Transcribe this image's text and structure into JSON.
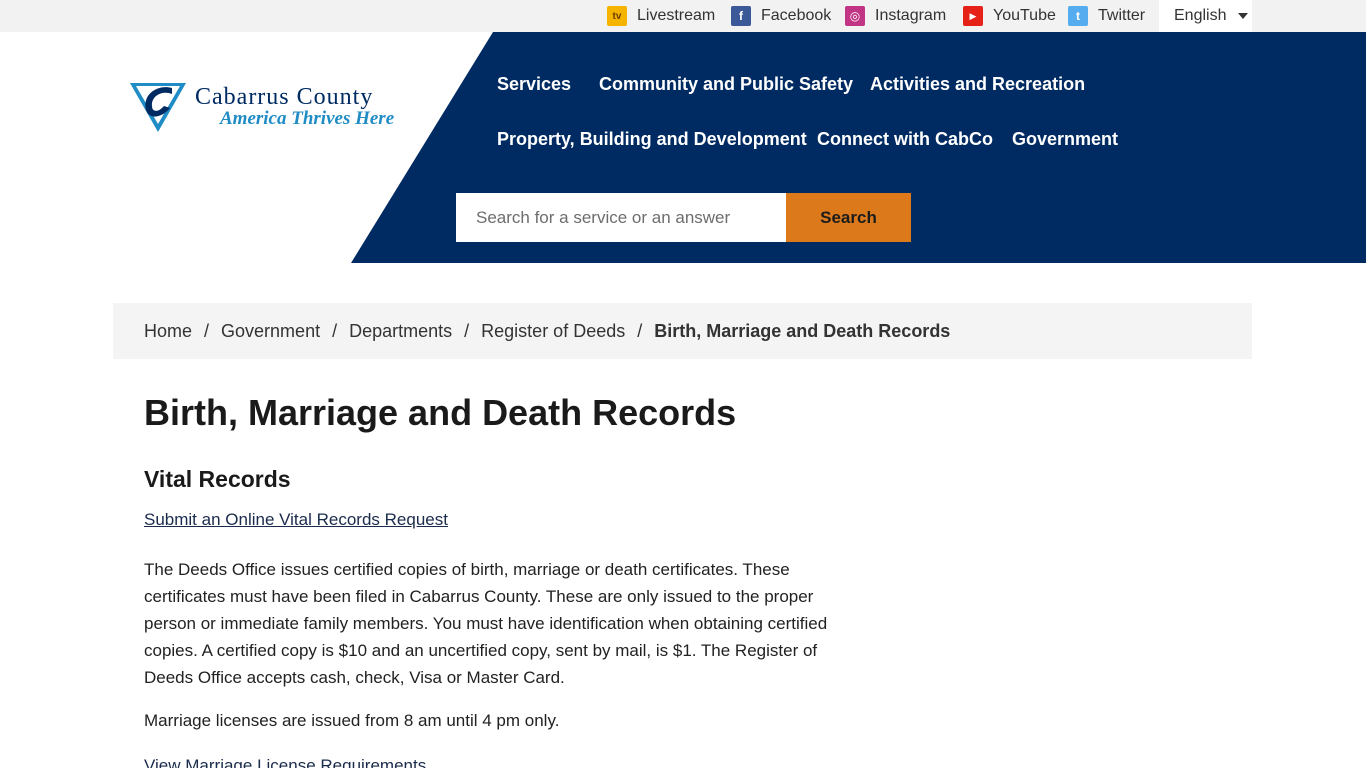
{
  "topbar": {
    "social": [
      {
        "label": "Livestream",
        "icon": "tv-icon",
        "color": "#f4b400",
        "glyph": "tv"
      },
      {
        "label": "Facebook",
        "icon": "facebook-icon",
        "color": "#3b5998",
        "glyph": "f"
      },
      {
        "label": "Instagram",
        "icon": "instagram-icon",
        "color": "#c13584",
        "glyph": "◎"
      },
      {
        "label": "YouTube",
        "icon": "youtube-icon",
        "color": "#e62117",
        "glyph": "▶"
      },
      {
        "label": "Twitter",
        "icon": "twitter-icon",
        "color": "#55acee",
        "glyph": "t"
      }
    ],
    "language": "English"
  },
  "header": {
    "logo": {
      "name": "Cabarrus County",
      "tagline": "America Thrives Here"
    },
    "nav": {
      "services": "Services",
      "community": "Community and Public Safety",
      "activities": "Activities and Recreation",
      "property": "Property, Building and Development",
      "connect": "Connect with CabCo",
      "government": "Government"
    },
    "search": {
      "placeholder": "Search for a service or an answer",
      "button": "Search"
    },
    "colors": {
      "navy": "#002b62",
      "orange": "#dc7a1b"
    }
  },
  "breadcrumb": {
    "items": [
      "Home",
      "Government",
      "Departments",
      "Register of Deeds"
    ],
    "current": "Birth, Marriage and Death Records",
    "separator": "/"
  },
  "main": {
    "title": "Birth, Marriage and Death Records",
    "subtitle": "Vital Records",
    "link_request": "Submit an Online Vital Records Request",
    "paragraph": "The Deeds Office issues certified copies of birth, marriage or death certificates. These certificates must have been filed in Cabarrus County. These are only issued to the proper person or immediate family members. You must have identification when obtaining certified copies. A certified copy is $10 and an uncertified copy, sent by mail, is $1. The Register of Deeds Office accepts cash, check, Visa or Master Card.",
    "hours": "Marriage licenses are issued from 8 am until 4 pm only.",
    "link_requirements": "View Marriage License Requirements"
  }
}
